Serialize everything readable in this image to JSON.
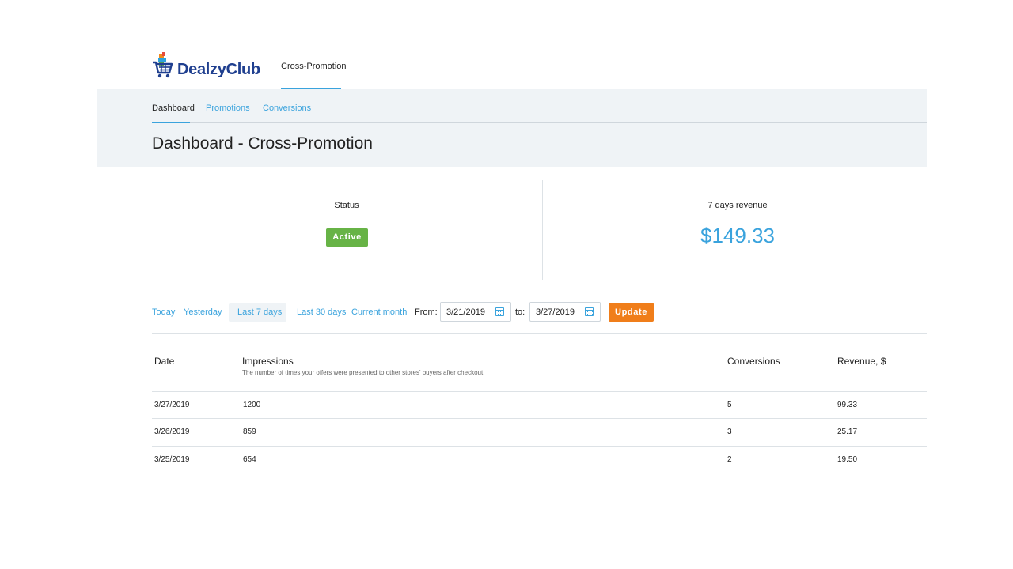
{
  "header": {
    "logo_text": "DealzyClub",
    "app_tab_label": "Cross-Promotion"
  },
  "subnav": {
    "items": [
      {
        "label": "Dashboard",
        "active": true
      },
      {
        "label": "Promotions",
        "active": false
      },
      {
        "label": "Conversions",
        "active": false
      }
    ]
  },
  "page": {
    "title": "Dashboard - Cross-Promotion"
  },
  "stats": {
    "status_label": "Status",
    "status_value": "Active",
    "revenue_label": "7 days revenue",
    "revenue_value": "$149.33"
  },
  "filters": {
    "presets": [
      "Today",
      "Yesterday",
      "Last 7 days",
      "Last 30 days",
      "Current month"
    ],
    "active_preset": "Last 7 days",
    "from_label": "From:",
    "from_value": "3/21/2019",
    "to_label": "to:",
    "to_value": "3/27/2019",
    "update_label": "Update"
  },
  "table": {
    "columns": [
      {
        "label": "Date"
      },
      {
        "label": "Impressions",
        "description": "The number of times your offers were presented to other stores' buyers after checkout"
      },
      {
        "label": "Conversions"
      },
      {
        "label": "Revenue, $"
      }
    ],
    "rows": [
      [
        "3/27/2019",
        "1200",
        "5",
        "99.33"
      ],
      [
        "3/26/2019",
        "859",
        "3",
        "25.17"
      ],
      [
        "3/25/2019",
        "654",
        "2",
        "19.50"
      ]
    ]
  },
  "colors": {
    "accent": "#3aa3dd",
    "active_badge": "#67b346",
    "update_button": "#f07e1a",
    "brand_navy": "#1f3f8f",
    "band_background": "#eff3f6"
  },
  "icons": {
    "logo": "shopping-cart-icon",
    "date_picker": "calendar-icon"
  }
}
